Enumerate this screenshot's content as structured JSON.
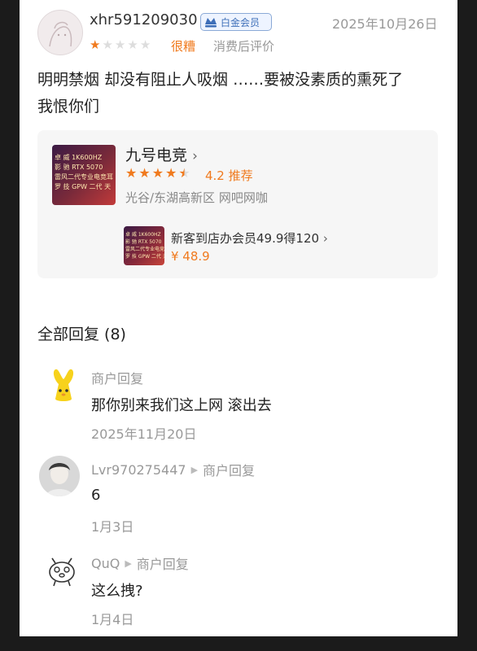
{
  "review": {
    "username": "xhr591209030",
    "vip_label": "白金会员",
    "date": "2025年10月26日",
    "stars_filled": 1,
    "stars_total": 5,
    "rating_word": "很糟",
    "rating_note": "消费后评价",
    "comment_line1": "明明禁烟 却没有阻止人吸烟 ……要被没素质的熏死了",
    "comment_line2": "我恨你们"
  },
  "shop": {
    "name": "九号电竞",
    "stars": 4.2,
    "score_text": "4.2 推荐",
    "area": "光谷/东湖高新区 网吧网咖",
    "image_lines": [
      "卓 威 1K600HZ",
      "影 驰 RTX 5070",
      "雷风二代专业电竞耳",
      "罗 技 GPW 二代 天"
    ],
    "deal": {
      "title": "新客到店办会员49.9得120",
      "price": "¥ 48.9"
    }
  },
  "replies": {
    "header": "全部回复 (8)",
    "items": [
      {
        "name": "商户回复",
        "text": "那你别来我们这上网 滚出去",
        "date": "2025年11月20日"
      },
      {
        "name": "Lvr970275447",
        "tag": "商户回复",
        "text": "6",
        "date": "1月3日"
      },
      {
        "name": "QuQ",
        "tag": "商户回复",
        "text": "这么拽?",
        "date": "1月4日"
      }
    ]
  },
  "colors": {
    "accent": "#f07a1e",
    "vip": "#3e6fb8",
    "muted": "#999999"
  }
}
